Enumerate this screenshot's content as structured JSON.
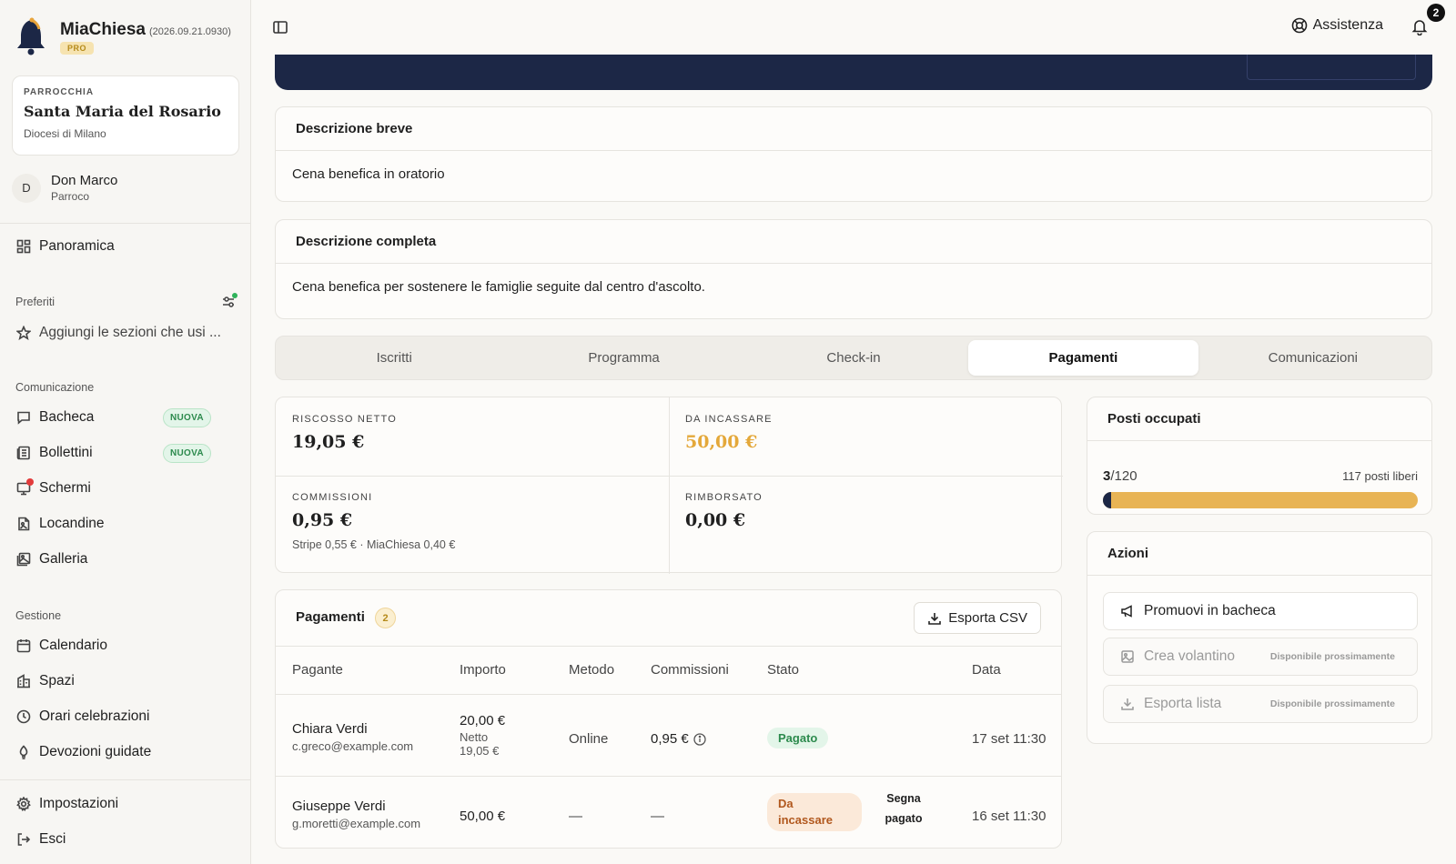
{
  "app": {
    "name": "MiaChiesa",
    "version": "(2026.09.21.0930)",
    "tier": "PRO"
  },
  "parish": {
    "label": "PARROCCHIA",
    "name": "Santa Maria del Rosario",
    "diocese": "Diocesi di Milano"
  },
  "user": {
    "initial": "D",
    "name": "Don Marco",
    "role": "Parroco"
  },
  "sidebar": {
    "overview": "Panoramica",
    "favorites_label": "Preferiti",
    "favorites_add": "Aggiungi le sezioni che usi ...",
    "communication_label": "Comunicazione",
    "communication": [
      {
        "label": "Bacheca",
        "badge": "NUOVA",
        "icon": "message-icon"
      },
      {
        "label": "Bollettini",
        "badge": "NUOVA",
        "icon": "newspaper-icon"
      },
      {
        "label": "Schermi",
        "icon": "screen-icon"
      },
      {
        "label": "Locandine",
        "icon": "poster-icon"
      },
      {
        "label": "Galleria",
        "icon": "gallery-icon"
      }
    ],
    "management_label": "Gestione",
    "management": [
      {
        "label": "Calendario",
        "icon": "calendar-icon"
      },
      {
        "label": "Spazi",
        "icon": "building-icon"
      },
      {
        "label": "Orari celebrazioni",
        "icon": "clock-icon"
      },
      {
        "label": "Devozioni guidate",
        "icon": "candle-icon"
      }
    ],
    "settings": "Impostazioni",
    "logout": "Esci"
  },
  "topbar": {
    "help": "Assistenza",
    "notifications_count": "2"
  },
  "short_description": {
    "title": "Descrizione breve",
    "text": "Cena benefica in oratorio"
  },
  "full_description": {
    "title": "Descrizione completa",
    "text": "Cena benefica per sostenere le famiglie seguite dal centro d'ascolto."
  },
  "tabs": [
    "Iscritti",
    "Programma",
    "Check-in",
    "Pagamenti",
    "Comunicazioni"
  ],
  "active_tab": "Pagamenti",
  "stats": {
    "net": {
      "label": "RISCOSSO NETTO",
      "value": "19,05 €"
    },
    "due": {
      "label": "DA INCASSARE",
      "value": "50,00 €"
    },
    "fees": {
      "label": "COMMISSIONI",
      "value": "0,95 €",
      "detail": "Stripe 0,55 € · MiaChiesa 0,40 €"
    },
    "refunded": {
      "label": "RIMBORSATO",
      "value": "0,00 €"
    }
  },
  "payments": {
    "title": "Pagamenti",
    "count": "2",
    "export": "Esporta CSV",
    "columns": [
      "Pagante",
      "Importo",
      "Metodo",
      "Commissioni",
      "Stato",
      "Data"
    ],
    "rows": [
      {
        "name": "Chiara Verdi",
        "email": "c.greco@example.com",
        "amount": "20,00 €",
        "net_label": "Netto",
        "net": "19,05 €",
        "method": "Online",
        "fee": "0,95 €",
        "status": "Pagato",
        "date": "17 set 11:30"
      },
      {
        "name": "Giuseppe Verdi",
        "email": "g.moretti@example.com",
        "amount": "50,00 €",
        "method": "—",
        "fee": "—",
        "status": "Da incassare",
        "action": "Segna pagato",
        "date": "16 set 11:30"
      }
    ]
  },
  "seats": {
    "title": "Posti occupati",
    "occupied": "3",
    "total": "/120",
    "free": "117 posti liberi",
    "fill_fraction": 0.025
  },
  "actions": {
    "title": "Azioni",
    "promote": "Promuovi in bacheca",
    "flyer": "Crea volantino",
    "export_list": "Esporta lista",
    "soon": "Disponibile prossimamente"
  },
  "colors": {
    "navy": "#1c2746",
    "accent_gold": "#e8b455",
    "due_amount": "#e4a83a",
    "paid_green": "#2c8a4d",
    "due_orange": "#b1581e"
  }
}
